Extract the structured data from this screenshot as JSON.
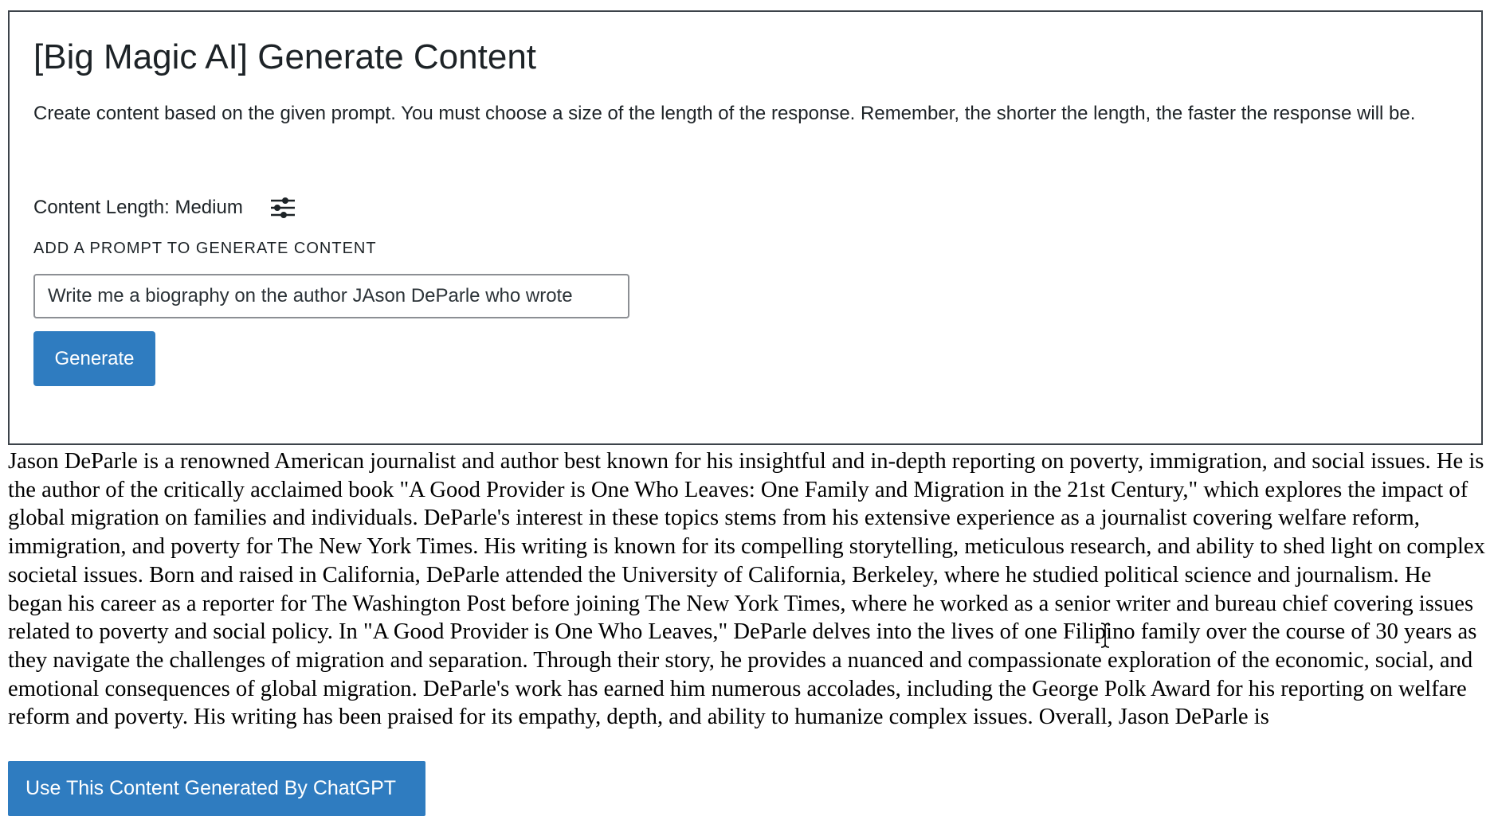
{
  "header": {
    "title": "[Big Magic AI] Generate Content",
    "description": "Create content based on the given prompt. You must choose a size of the length of the response. Remember, the shorter the length, the faster the response will be."
  },
  "settings": {
    "content_length_label": "Content Length: Medium",
    "icon": "sliders-icon"
  },
  "prompt": {
    "label": "ADD A PROMPT TO GENERATE CONTENT",
    "value": "Write me a biography on the author JAson DeParle who wrote"
  },
  "buttons": {
    "generate_label": "Generate",
    "use_content_label": "Use This Content Generated By ChatGPT"
  },
  "output": {
    "text": "Jason DeParle is a renowned American journalist and author best known for his insightful and in-depth reporting on poverty, immigration, and social issues. He is the author of the critically acclaimed book \"A Good Provider is One Who Leaves: One Family and Migration in the 21st Century,\" which explores the impact of global migration on families and individuals. DeParle's interest in these topics stems from his extensive experience as a journalist covering welfare reform, immigration, and poverty for The New York Times. His writing is known for its compelling storytelling, meticulous research, and ability to shed light on complex societal issues. Born and raised in California, DeParle attended the University of California, Berkeley, where he studied political science and journalism. He began his career as a reporter for The Washington Post before joining The New York Times, where he worked as a senior writer and bureau chief covering issues related to poverty and social policy. In \"A Good Provider is One Who Leaves,\" DeParle delves into the lives of one Filipino family over the course of 30 years as they navigate the challenges of migration and separation. Through their story, he provides a nuanced and compassionate exploration of the economic, social, and emotional consequences of global migration. DeParle's work has earned him numerous accolades, including the George Polk Award for his reporting on welfare reform and poverty. His writing has been praised for its empathy, depth, and ability to humanize complex issues. Overall, Jason DeParle is"
  },
  "colors": {
    "primary_button": "#2f7cc0",
    "text": "#1d2327",
    "border": "#3c434a"
  }
}
